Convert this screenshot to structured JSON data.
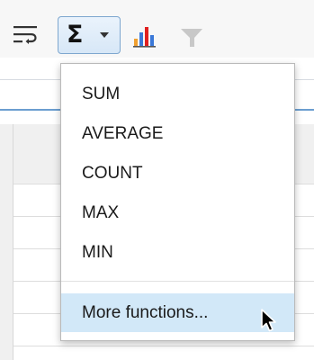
{
  "toolbar": {
    "buttons": [
      {
        "name": "wrap-text",
        "icon": "wrap-text-icon"
      },
      {
        "name": "sum",
        "icon": "sigma-icon",
        "glyph": "Σ",
        "state": "pressed"
      },
      {
        "name": "chart",
        "icon": "bar-chart-icon"
      },
      {
        "name": "filter",
        "icon": "filter-icon",
        "state": "disabled"
      }
    ]
  },
  "menu": {
    "items": [
      {
        "label": "SUM"
      },
      {
        "label": "AVERAGE"
      },
      {
        "label": "COUNT"
      },
      {
        "label": "MAX"
      },
      {
        "label": "MIN"
      }
    ],
    "more": {
      "label": "More functions...",
      "state": "hovered"
    }
  },
  "colors": {
    "accent": "#6b9ed0",
    "pressed_border": "#7ea7cf",
    "highlight": "#d2e8f8",
    "chart_orange": "#f0a030",
    "chart_blue": "#3a78d8",
    "chart_red": "#e02020"
  }
}
